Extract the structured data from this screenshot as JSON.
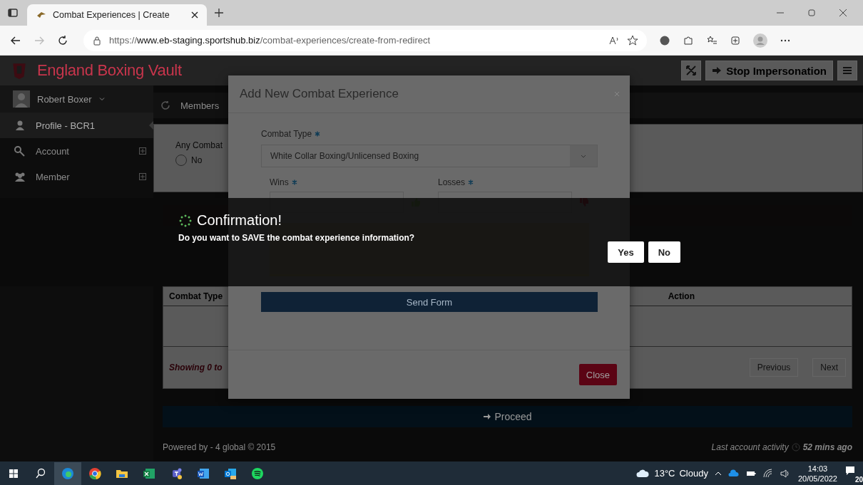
{
  "browser": {
    "tab_title": "Combat Experiences | Create",
    "url": "https://**www.eb-staging.sportshub.biz**/combat-experiences/create-from-redirect"
  },
  "app": {
    "title": "England Boxing Vault",
    "impersonation_button": "Stop Impersonation"
  },
  "sidebar": {
    "user": "Robert Boxer",
    "items": [
      {
        "label": "Profile - BCR1",
        "kind": "profile",
        "selected": true,
        "expandable": false
      },
      {
        "label": "Account",
        "kind": "account",
        "selected": false,
        "expandable": true
      },
      {
        "label": "Member",
        "kind": "member",
        "selected": false,
        "expandable": true
      }
    ]
  },
  "page": {
    "breadcrumb": "Members",
    "question": "Any Combat",
    "radios": [
      {
        "label": "No",
        "selected": false
      }
    ],
    "table": {
      "columns": [
        "Combat Type",
        "Action"
      ]
    },
    "info": "Showing 0 to",
    "pagination": [
      "Previous",
      "Next"
    ],
    "proceed": "Proceed",
    "footer": "Powered by - 4 global © 2015",
    "last_activity": "Last account activity",
    "last_activity_time": "52 mins ago"
  },
  "modal": {
    "title": "Add New Combat Experience",
    "combat_type_label": "Combat Type",
    "combat_type_value": "White Collar Boxing/Unlicensed Boxing",
    "wins_label": "Wins",
    "losses_label": "Losses",
    "send_button": "Send Form",
    "close_button": "Close"
  },
  "confirmation": {
    "title": "Confirmation!",
    "message": "Do you want to SAVE the combat experience information?",
    "buttons": [
      "Yes",
      "No"
    ]
  },
  "taskbar": {
    "temperature": "13°C",
    "weather": "Cloudy",
    "time": "14:03",
    "date": "20/05/2022",
    "notifications": "20"
  }
}
